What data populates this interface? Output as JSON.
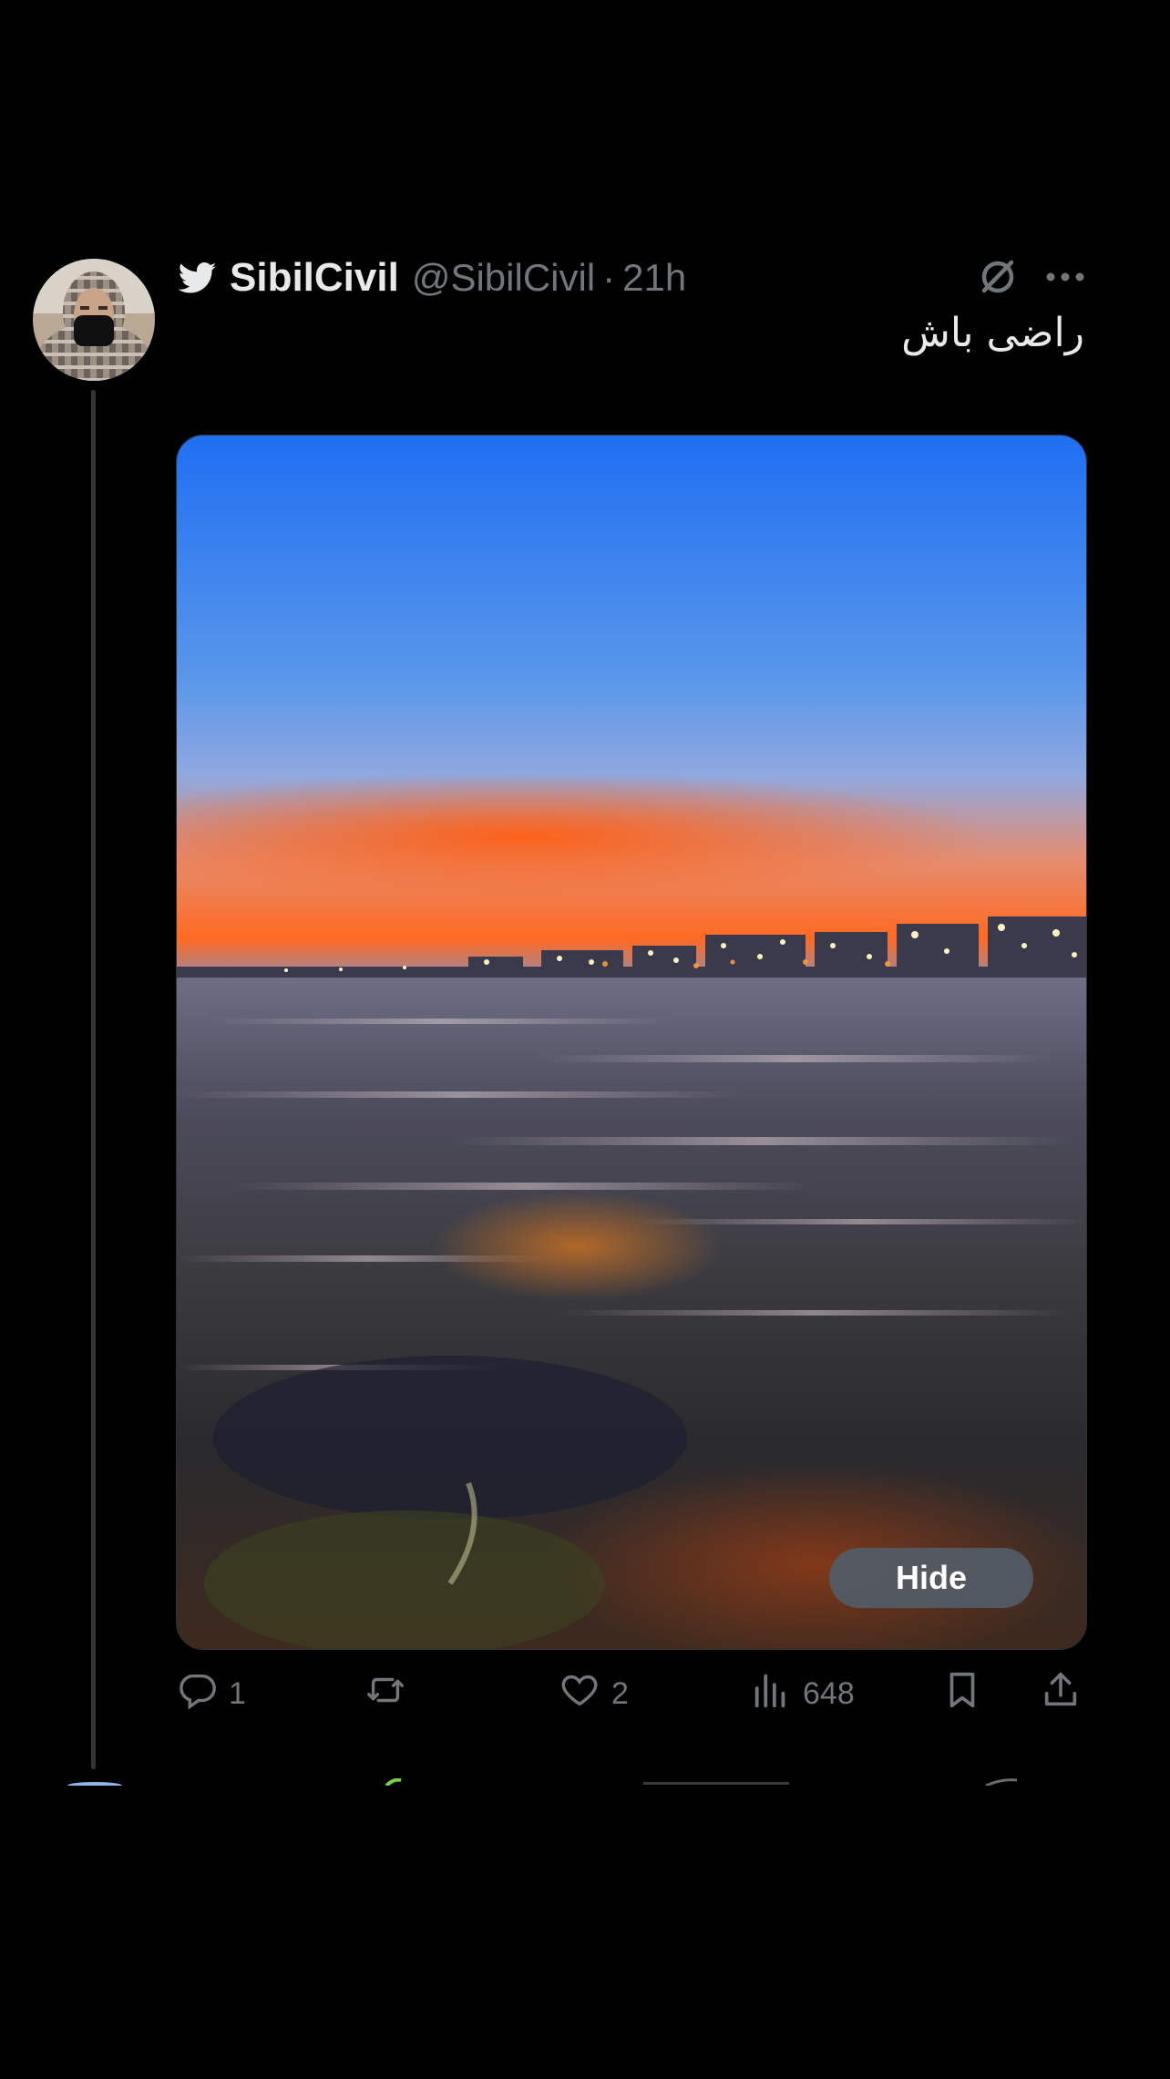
{
  "tweet": {
    "display_name": "SibilCivil",
    "handle": "@SibilCivil",
    "separator": "·",
    "time": "21h",
    "text": "راضی باش",
    "media": {
      "hide_label": "Hide"
    },
    "actions": {
      "replies": "1",
      "retweets": "",
      "likes": "2",
      "views": "648"
    }
  },
  "colors": {
    "background": "#000000",
    "primary_text": "#e7e9ea",
    "secondary_text": "#71767b",
    "thread_line": "#333639",
    "hide_button_bg": "#535c67"
  },
  "icons": {
    "verified_badge": "twitter-bird-icon",
    "grok": "grok-icon",
    "more": "more-icon",
    "reply": "reply-icon",
    "retweet": "retweet-icon",
    "like": "heart-icon",
    "views": "views-icon",
    "bookmark": "bookmark-icon",
    "share": "share-icon"
  }
}
